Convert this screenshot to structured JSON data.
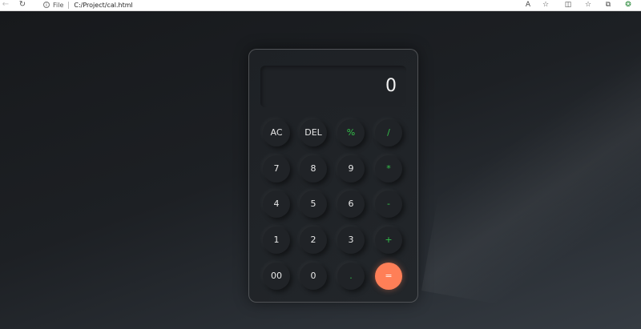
{
  "browser": {
    "back_icon": "←",
    "reload_icon": "↻",
    "info_icon": "i",
    "scheme_label": "File",
    "url": "C:/Project/cal.html",
    "read_aloud_icon": "A",
    "favorite_icon": "☆",
    "split_screen_icon": "◫",
    "favorites_bar_icon": "☆",
    "collections_icon": "⧉",
    "extension_icon": "❂"
  },
  "calculator": {
    "display_value": "0",
    "keys": [
      {
        "label": "AC",
        "type": "function"
      },
      {
        "label": "DEL",
        "type": "function"
      },
      {
        "label": "%",
        "type": "operator"
      },
      {
        "label": "/",
        "type": "operator"
      },
      {
        "label": "7",
        "type": "digit"
      },
      {
        "label": "8",
        "type": "digit"
      },
      {
        "label": "9",
        "type": "digit"
      },
      {
        "label": "*",
        "type": "operator"
      },
      {
        "label": "4",
        "type": "digit"
      },
      {
        "label": "5",
        "type": "digit"
      },
      {
        "label": "6",
        "type": "digit"
      },
      {
        "label": "-",
        "type": "operator"
      },
      {
        "label": "1",
        "type": "digit"
      },
      {
        "label": "2",
        "type": "digit"
      },
      {
        "label": "3",
        "type": "digit"
      },
      {
        "label": "+",
        "type": "operator"
      },
      {
        "label": "00",
        "type": "digit"
      },
      {
        "label": "0",
        "type": "digit"
      },
      {
        "label": ".",
        "type": "operator"
      },
      {
        "label": "=",
        "type": "equals"
      }
    ]
  },
  "colors": {
    "operator": "#33c24a",
    "equals": "#ff7f57",
    "background": "#1b1e22"
  }
}
